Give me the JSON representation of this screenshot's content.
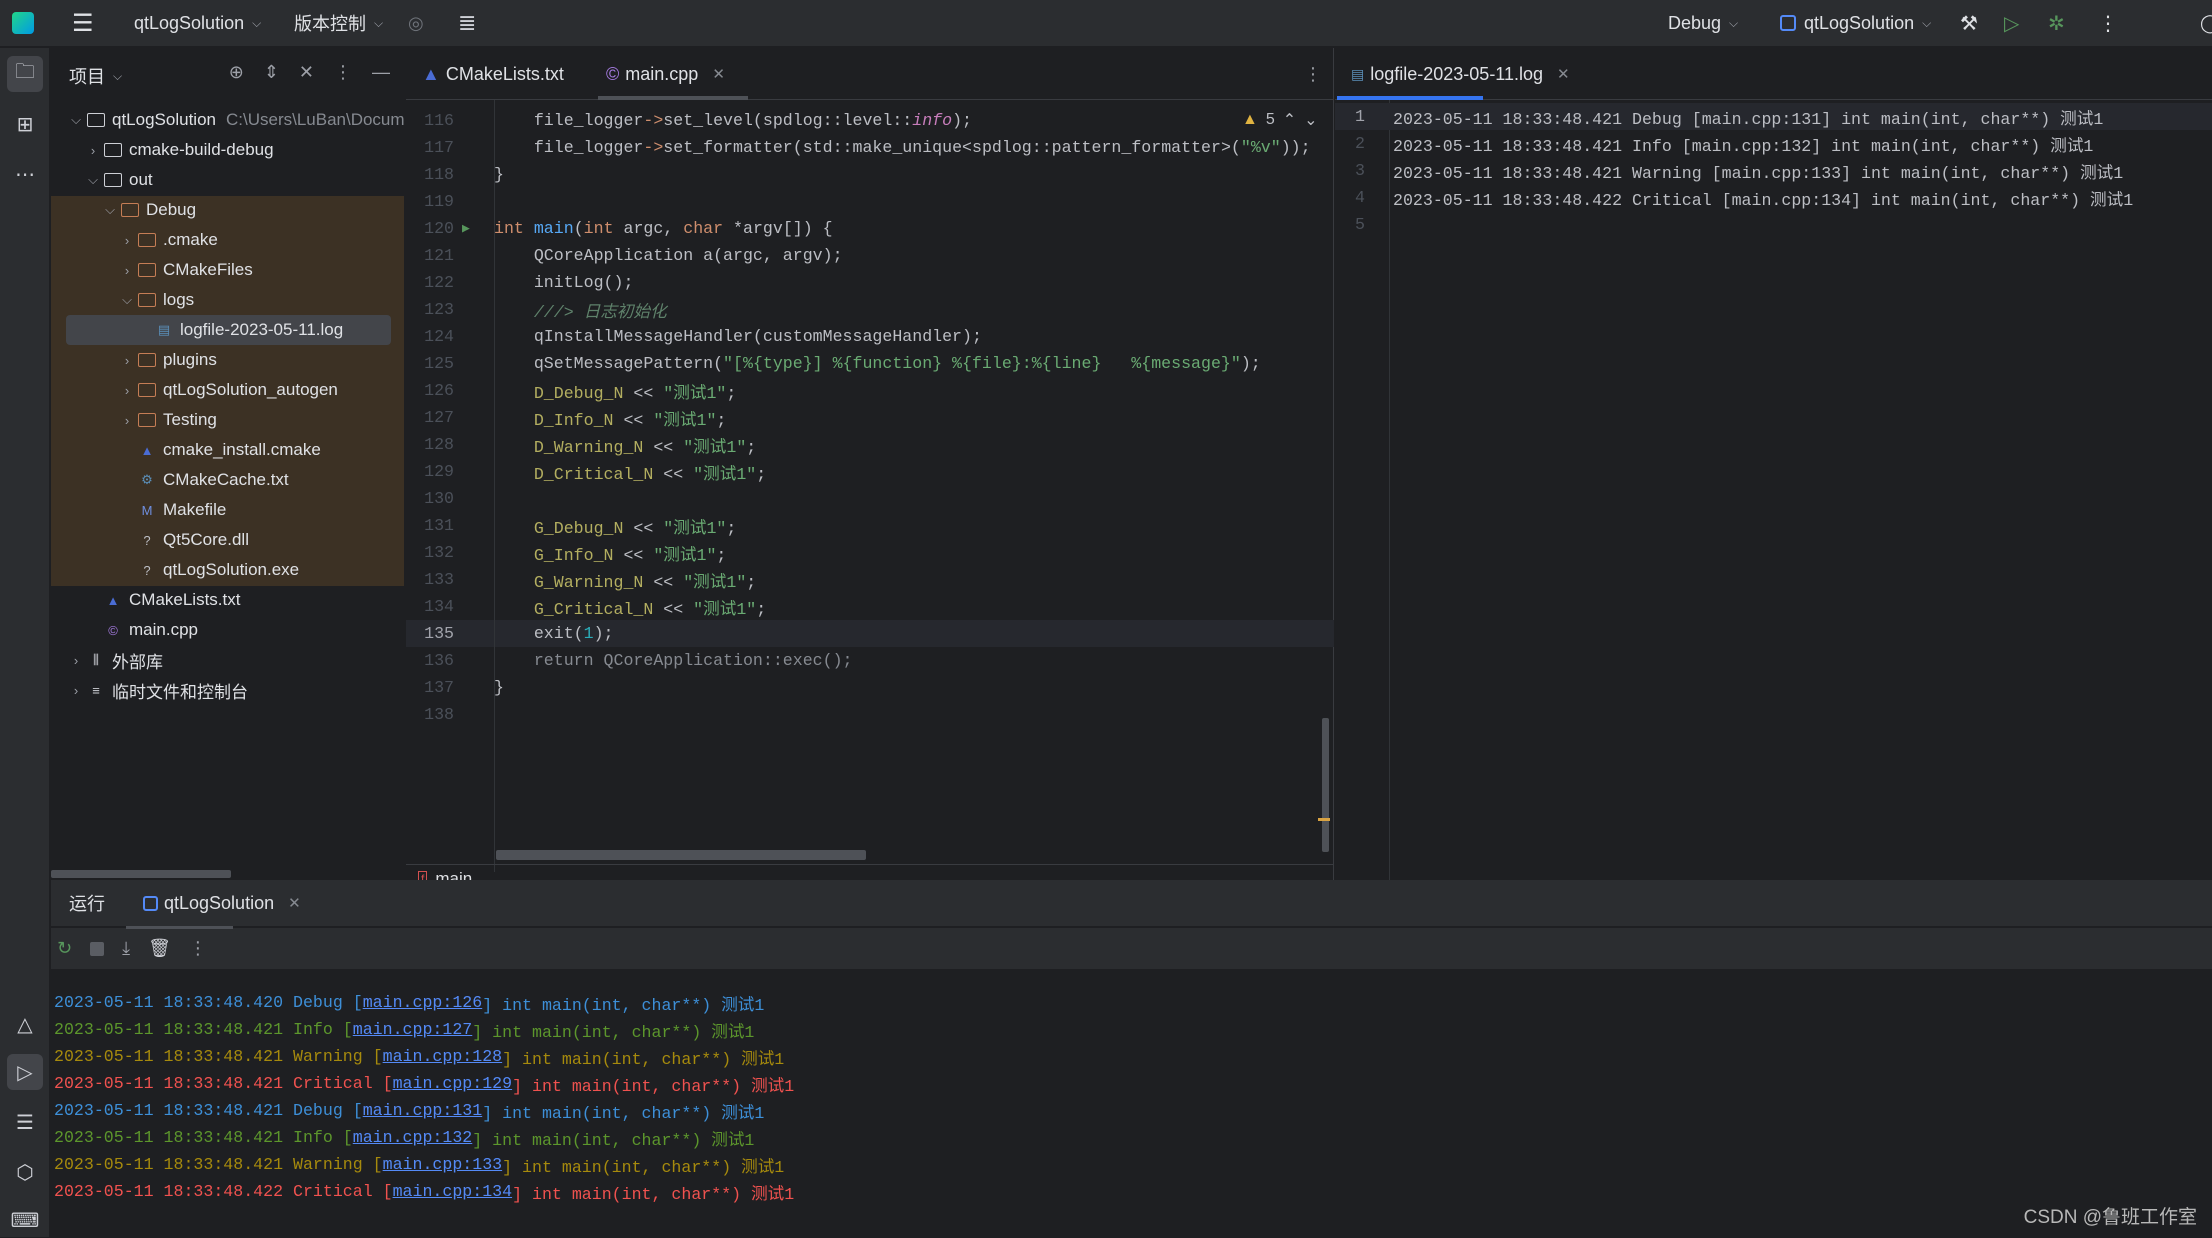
{
  "titlebar": {
    "project": "qtLogSolution",
    "vcs": "版本控制",
    "config": "Debug",
    "run_target": "qtLogSolution"
  },
  "project_panel": {
    "title": "项目",
    "tree": [
      {
        "level": 0,
        "type": "folder",
        "label": "qtLogSolution",
        "hint": "C:\\Users\\LuBan\\Docum",
        "expanded": true
      },
      {
        "level": 1,
        "type": "folder",
        "label": "cmake-build-debug",
        "expanded": false
      },
      {
        "level": 1,
        "type": "folder",
        "label": "out",
        "expanded": true
      },
      {
        "level": 2,
        "type": "folder-brown",
        "label": "Debug",
        "expanded": true
      },
      {
        "level": 3,
        "type": "folder-brown",
        "label": ".cmake",
        "expanded": false
      },
      {
        "level": 3,
        "type": "folder-brown",
        "label": "CMakeFiles",
        "expanded": false
      },
      {
        "level": 3,
        "type": "folder-brown",
        "label": "logs",
        "expanded": true
      },
      {
        "level": 4,
        "type": "log",
        "label": "logfile-2023-05-11.log",
        "selected": true
      },
      {
        "level": 3,
        "type": "folder-brown",
        "label": "plugins",
        "expanded": false
      },
      {
        "level": 3,
        "type": "folder-brown",
        "label": "qtLogSolution_autogen",
        "expanded": false
      },
      {
        "level": 3,
        "type": "folder-brown",
        "label": "Testing",
        "expanded": false
      },
      {
        "level": 3,
        "type": "cmake",
        "label": "cmake_install.cmake"
      },
      {
        "level": 3,
        "type": "cache",
        "label": "CMakeCache.txt"
      },
      {
        "level": 3,
        "type": "make",
        "label": "Makefile"
      },
      {
        "level": 3,
        "type": "unknown",
        "label": "Qt5Core.dll"
      },
      {
        "level": 3,
        "type": "unknown",
        "label": "qtLogSolution.exe"
      },
      {
        "level": 1,
        "type": "cmake",
        "label": "CMakeLists.txt"
      },
      {
        "level": 1,
        "type": "cpp",
        "label": "main.cpp"
      },
      {
        "level": 0,
        "type": "lib",
        "label": "外部库",
        "expanded": false
      },
      {
        "level": 0,
        "type": "scratch",
        "label": "临时文件和控制台",
        "expanded": false
      }
    ]
  },
  "editor": {
    "tabs": [
      {
        "label": "CMakeLists.txt",
        "icon": "cmake-icon"
      },
      {
        "label": "main.cpp",
        "icon": "cpp-icon",
        "active": true
      }
    ],
    "warnings": "5",
    "current_line": 135,
    "breadcrumb": "main",
    "lines": [
      {
        "n": 116,
        "t": [
          [
            "    file_logger",
            "t"
          ],
          [
            "->",
            "o"
          ],
          [
            "set_level(spdlog::level::",
            "t"
          ],
          [
            "info",
            "p"
          ],
          [
            ");",
            "t"
          ]
        ]
      },
      {
        "n": 117,
        "t": [
          [
            "    file_logger",
            "t"
          ],
          [
            "->",
            "o"
          ],
          [
            "set_formatter(std::make_unique<spdlog::pattern_formatter>(",
            "t"
          ],
          [
            "\"%v\"",
            "s"
          ],
          [
            "));",
            "t"
          ]
        ]
      },
      {
        "n": 118,
        "t": [
          [
            "}",
            "t"
          ]
        ]
      },
      {
        "n": 119,
        "t": []
      },
      {
        "n": 120,
        "run": true,
        "t": [
          [
            "int ",
            "k"
          ],
          [
            "main",
            "f"
          ],
          [
            "(",
            "t"
          ],
          [
            "int ",
            "k"
          ],
          [
            "argc, ",
            "t"
          ],
          [
            "char ",
            "k"
          ],
          [
            "*argv[]) {",
            "t"
          ]
        ]
      },
      {
        "n": 121,
        "t": [
          [
            "    QCoreApplication a(argc, argv);",
            "t"
          ]
        ]
      },
      {
        "n": 122,
        "t": [
          [
            "    initLog();",
            "t"
          ]
        ]
      },
      {
        "n": 123,
        "t": [
          [
            "    ///> 日志初始化",
            "c"
          ]
        ]
      },
      {
        "n": 124,
        "t": [
          [
            "    qInstallMessageHandler(customMessageHandler);",
            "t"
          ]
        ]
      },
      {
        "n": 125,
        "t": [
          [
            "    qSetMessagePattern(",
            "t"
          ],
          [
            "\"[%{type}] %{function} %{file}:%{line}   %{message}\"",
            "s"
          ],
          [
            ");",
            "t"
          ]
        ]
      },
      {
        "n": 126,
        "t": [
          [
            "    D_Debug_N",
            "m"
          ],
          [
            " << ",
            "t"
          ],
          [
            "\"测试1\"",
            "s"
          ],
          [
            ";",
            "t"
          ]
        ]
      },
      {
        "n": 127,
        "t": [
          [
            "    D_Info_N",
            "m"
          ],
          [
            " << ",
            "t"
          ],
          [
            "\"测试1\"",
            "s"
          ],
          [
            ";",
            "t"
          ]
        ]
      },
      {
        "n": 128,
        "t": [
          [
            "    D_Warning_N",
            "m"
          ],
          [
            " << ",
            "t"
          ],
          [
            "\"测试1\"",
            "s"
          ],
          [
            ";",
            "t"
          ]
        ]
      },
      {
        "n": 129,
        "t": [
          [
            "    D_Critical_N",
            "m"
          ],
          [
            " << ",
            "t"
          ],
          [
            "\"测试1\"",
            "s"
          ],
          [
            ";",
            "t"
          ]
        ]
      },
      {
        "n": 130,
        "t": []
      },
      {
        "n": 131,
        "t": [
          [
            "    G_Debug_N",
            "m"
          ],
          [
            " << ",
            "t"
          ],
          [
            "\"测试1\"",
            "s"
          ],
          [
            ";",
            "t"
          ]
        ]
      },
      {
        "n": 132,
        "t": [
          [
            "    G_Info_N",
            "m"
          ],
          [
            " << ",
            "t"
          ],
          [
            "\"测试1\"",
            "s"
          ],
          [
            ";",
            "t"
          ]
        ]
      },
      {
        "n": 133,
        "t": [
          [
            "    G_Warning_N",
            "m"
          ],
          [
            " << ",
            "t"
          ],
          [
            "\"测试1\"",
            "s"
          ],
          [
            ";",
            "t"
          ]
        ]
      },
      {
        "n": 134,
        "t": [
          [
            "    G_Critical_N",
            "m"
          ],
          [
            " << ",
            "t"
          ],
          [
            "\"测试1\"",
            "s"
          ],
          [
            ";",
            "t"
          ]
        ]
      },
      {
        "n": 135,
        "t": [
          [
            "    exit(",
            "t"
          ],
          [
            "1",
            "n"
          ],
          [
            ");",
            "t"
          ]
        ]
      },
      {
        "n": 136,
        "t": [
          [
            "    return QCoreApplication::exec();",
            "g"
          ]
        ]
      },
      {
        "n": 137,
        "t": [
          [
            "}",
            "t"
          ]
        ]
      },
      {
        "n": 138,
        "t": []
      }
    ]
  },
  "log_editor": {
    "tab": "logfile-2023-05-11.log",
    "lines": [
      "2023-05-11 18:33:48.421 Debug [main.cpp:131] int main(int, char**) 测试1",
      "2023-05-11 18:33:48.421 Info [main.cpp:132] int main(int, char**) 测试1",
      "2023-05-11 18:33:48.421 Warning [main.cpp:133] int main(int, char**) 测试1",
      "2023-05-11 18:33:48.422 Critical [main.cpp:134] int main(int, char**) 测试1",
      ""
    ]
  },
  "run_panel": {
    "title": "运行",
    "tab": "qtLogSolution",
    "colors": {
      "Debug": "#3d8fd8",
      "Info": "#5c962c",
      "Warning": "#a68a0d",
      "Critical": "#f0524f"
    },
    "lines": [
      {
        "pre": "2023-05-11 18:33:48.420 Debug [",
        "link": "main.cpp:126",
        "post": "] int main(int, char**) 测试1",
        "level": "Debug"
      },
      {
        "pre": "2023-05-11 18:33:48.421 Info [",
        "link": "main.cpp:127",
        "post": "] int main(int, char**) 测试1",
        "level": "Info"
      },
      {
        "pre": "2023-05-11 18:33:48.421 Warning [",
        "link": "main.cpp:128",
        "post": "] int main(int, char**) 测试1",
        "level": "Warning"
      },
      {
        "pre": "2023-05-11 18:33:48.421 Critical [",
        "link": "main.cpp:129",
        "post": "] int main(int, char**) 测试1",
        "level": "Critical"
      },
      {
        "pre": "2023-05-11 18:33:48.421 Debug [",
        "link": "main.cpp:131",
        "post": "] int main(int, char**) 测试1",
        "level": "Debug"
      },
      {
        "pre": "2023-05-11 18:33:48.421 Info [",
        "link": "main.cpp:132",
        "post": "] int main(int, char**) 测试1",
        "level": "Info"
      },
      {
        "pre": "2023-05-11 18:33:48.421 Warning [",
        "link": "main.cpp:133",
        "post": "] int main(int, char**) 测试1",
        "level": "Warning"
      },
      {
        "pre": "2023-05-11 18:33:48.422 Critical [",
        "link": "main.cpp:134",
        "post": "] int main(int, char**) 测试1",
        "level": "Critical"
      }
    ]
  },
  "watermark": "CSDN @鲁班工作室"
}
